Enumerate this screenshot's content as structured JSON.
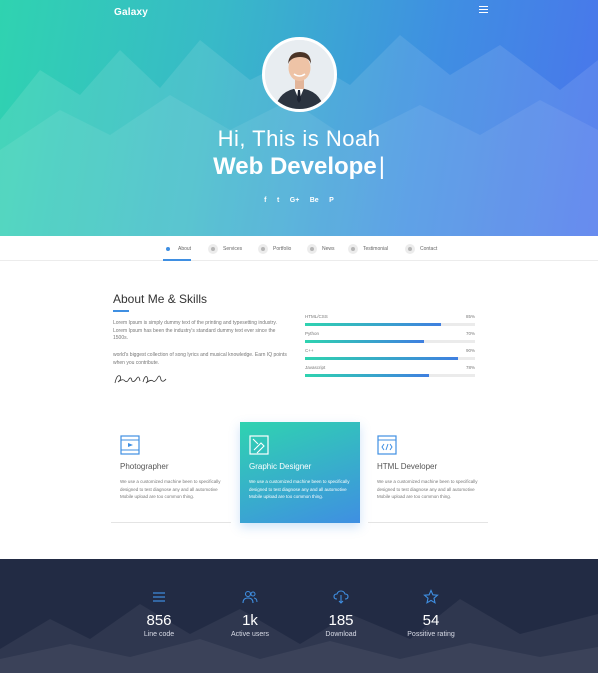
{
  "header": {
    "logo": "Galaxy",
    "menu_icon": "hamburger-icon"
  },
  "hero": {
    "greeting": "Hi, This is Noah",
    "role": "Web Develope",
    "caret": "|",
    "socials": [
      "f",
      "t",
      "G+",
      "Be",
      "P"
    ]
  },
  "nav": {
    "items": [
      {
        "label": "About",
        "icon": "person-icon",
        "active": true
      },
      {
        "label": "Services",
        "icon": "gear-icon",
        "active": false
      },
      {
        "label": "Portfolio",
        "icon": "grid-icon",
        "active": false
      },
      {
        "label": "News",
        "icon": "news-icon",
        "active": false
      },
      {
        "label": "Testimonial",
        "icon": "quote-icon",
        "active": false
      },
      {
        "label": "Contact",
        "icon": "send-icon",
        "active": false
      }
    ]
  },
  "about": {
    "title": "About Me & Skills",
    "paragraph1": "Lorem Ipsum is simply dummy text of the printing and typesetting industry. Lorem Ipsum has been the industry's standard dummy text ever since the 1500s.",
    "paragraph2": "world's biggest collection of song lyrics and musical knowledge. Earn IQ points when you contribute.",
    "signature_icon": "signature-icon"
  },
  "skills": [
    {
      "name": "HTML/CSS",
      "value": "85%",
      "level": 0.8
    },
    {
      "name": "Python",
      "value": "70%",
      "level": 0.7
    },
    {
      "name": "C++",
      "value": "90%",
      "level": 0.9
    },
    {
      "name": "Javascript",
      "value": "78%",
      "level": 0.73
    }
  ],
  "services": [
    {
      "title": "Photographer",
      "icon": "film-icon",
      "desc": "We use a customized machine been to specifically designed to test diagnose any and all automotive Mobile upload are too common thing."
    },
    {
      "title": "Graphic Designer",
      "icon": "pen-tool-icon",
      "desc": "We use a customized machine been to specifically designed to test diagnose any and all automotive Mobile upload are too common thing."
    },
    {
      "title": "HTML Developer",
      "icon": "code-icon",
      "desc": "We use a customized machine been to specifically designed to test diagnose any and all automotive Mobile upload are too common thing."
    }
  ],
  "stats": [
    {
      "number": "856",
      "label": "Line code",
      "icon": "lines-icon"
    },
    {
      "number": "1k",
      "label": "Active users",
      "icon": "users-icon"
    },
    {
      "number": "185",
      "label": "Download",
      "icon": "cloud-download-icon"
    },
    {
      "number": "54",
      "label": "Possitive rating",
      "icon": "star-icon"
    }
  ],
  "colors": {
    "accent": "#3f8fe2",
    "gradient_start": "#2fd3b0",
    "gradient_end": "#4a74ec",
    "stats_bg": "#222b44"
  }
}
